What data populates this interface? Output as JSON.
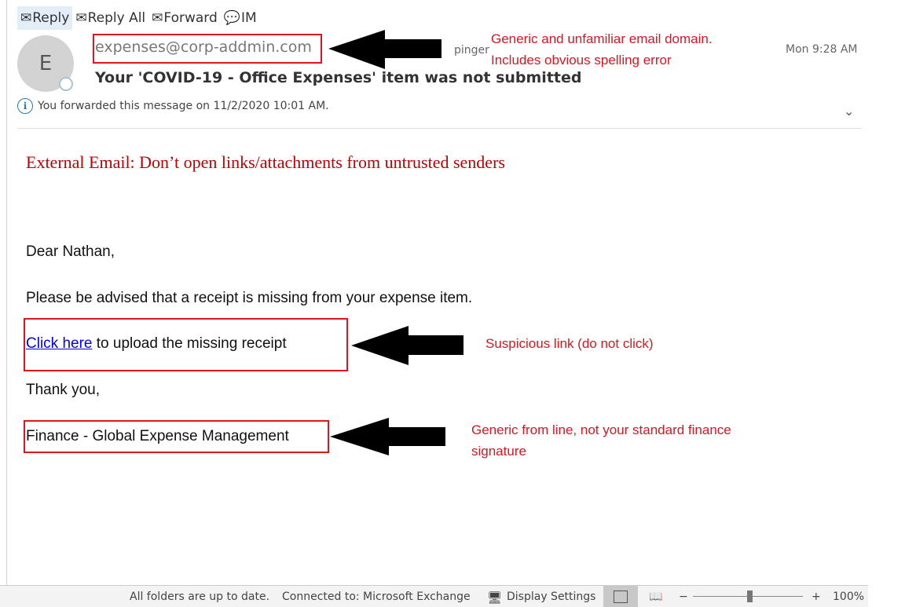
{
  "toolbar": {
    "reply": "Reply",
    "reply_all": "Reply All",
    "forward": "Forward",
    "im": "IM"
  },
  "message": {
    "avatar_initial": "E",
    "sender": "expenses@corp-addmin.com",
    "to_partial": "pinger",
    "subject": "Your 'COVID-19 - Office Expenses' item was not submitted",
    "time": "Mon 9:28 AM",
    "info": "You forwarded this message on 11/2/2020 10:01 AM."
  },
  "body": {
    "banner": "External Email: Don’t open links/attachments from untrusted senders",
    "greeting": "Dear  Nathan,",
    "line1": "Please be advised that a receipt is missing from your expense item.",
    "link_text": "Click here",
    "line2_rest": " to upload the missing receipt",
    "thanks": "Thank you,",
    "signature": "Finance - Global Expense Management"
  },
  "annotations": {
    "sender_note_1": "Generic and unfamiliar email domain.",
    "sender_note_2": "Includes obvious spelling error",
    "link_note": "Suspicious link (do not click)",
    "signature_note_1": "Generic from line, not your standard finance",
    "signature_note_2": "signature"
  },
  "status": {
    "sync": "All folders are up to date.",
    "connection": "Connected to: Microsoft Exchange",
    "display_settings": "Display Settings",
    "zoom": "100%",
    "zoom_level_percent": 100
  },
  "colors": {
    "annotation_red": "#e0141e",
    "banner_red": "#c00000",
    "link_blue": "#0000ee"
  }
}
